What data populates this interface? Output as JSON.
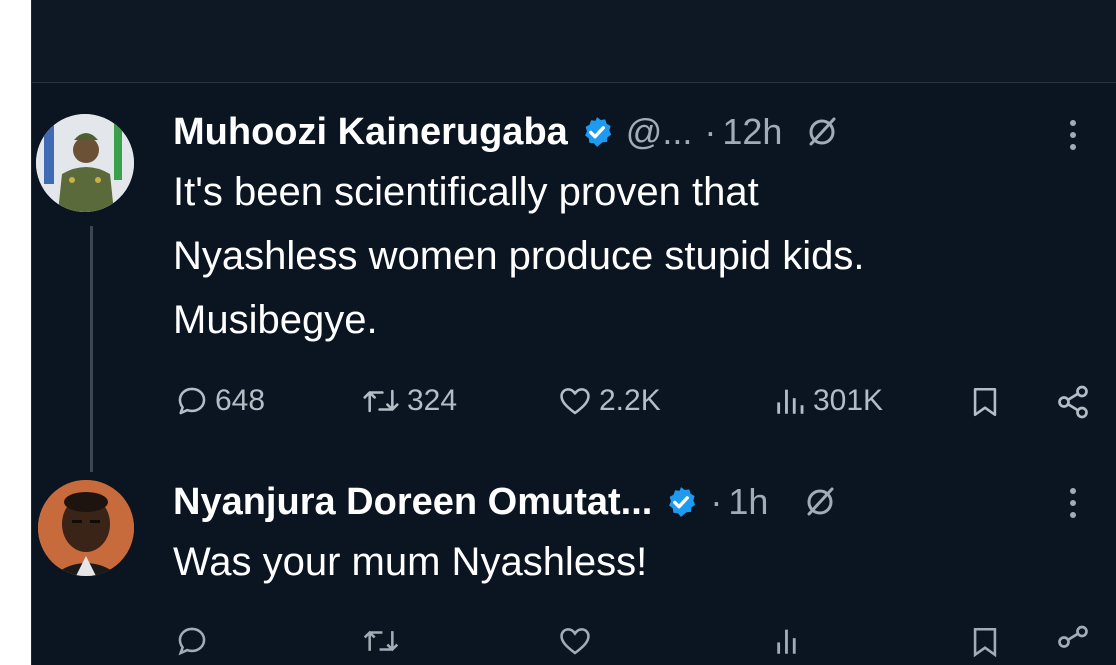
{
  "colors": {
    "background": "#0b1421",
    "text_primary": "#ffffff",
    "text_secondary": "#a3acb6",
    "verified_badge": "#1d9bf0"
  },
  "tweet1": {
    "author_name": "Muhoozi Kainerugaba",
    "handle": "@...",
    "separator": "·",
    "time": "12h",
    "text_lines": [
      "It's been scientifically proven that",
      "Nyashless women produce stupid kids.",
      "Musibegye."
    ],
    "replies": "648",
    "retweets": "324",
    "likes": "2.2K",
    "views": "301K"
  },
  "tweet2": {
    "author_name": "Nyanjura Doreen Omutat...",
    "separator": "·",
    "time": "1h",
    "text": "Was your mum Nyashless!"
  },
  "icons": {
    "verified": "verified-badge-icon",
    "grok": "grok-icon",
    "more": "more-options-icon",
    "reply": "reply-icon",
    "retweet": "retweet-icon",
    "like": "heart-icon",
    "views": "views-icon",
    "bookmark": "bookmark-icon",
    "share": "share-icon"
  }
}
